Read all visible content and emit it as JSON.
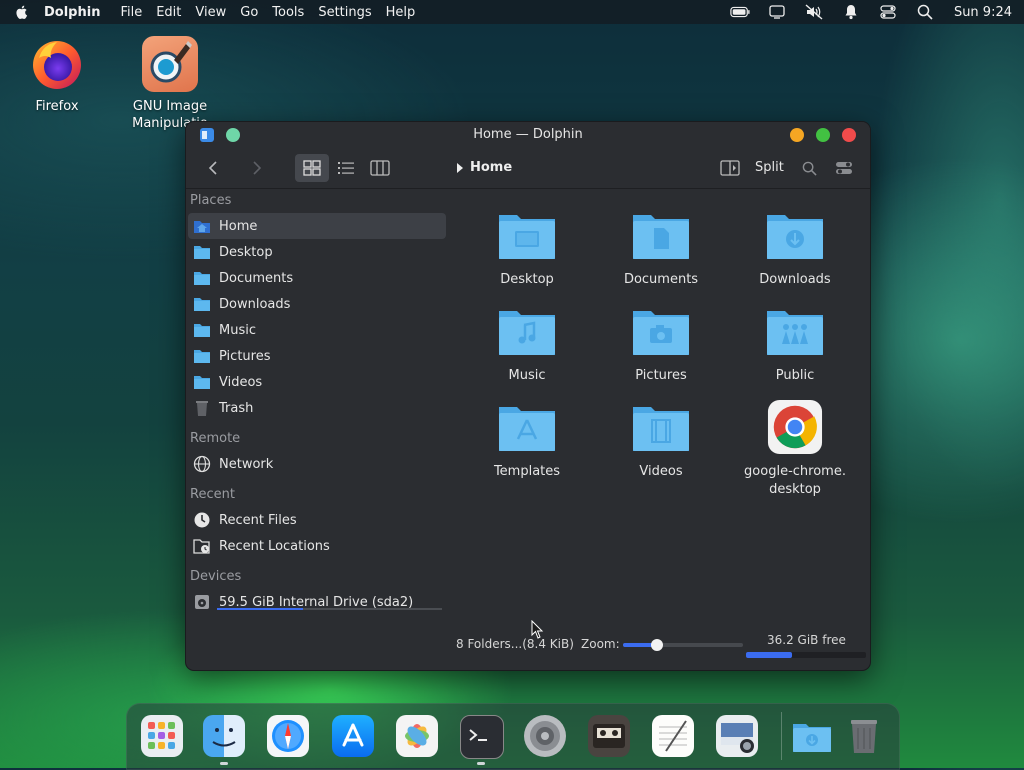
{
  "menubar": {
    "app_name": "Dolphin",
    "menus": [
      "File",
      "Edit",
      "View",
      "Go",
      "Tools",
      "Settings",
      "Help"
    ],
    "clock": "Sun 9:24",
    "status_icons": [
      "battery-icon",
      "display-icon",
      "mute-icon",
      "notification-icon",
      "control-center-icon",
      "search-icon"
    ]
  },
  "desktop": {
    "icons": [
      {
        "label": "Firefox",
        "icon": "firefox-icon"
      },
      {
        "label": "GNU Image Manipulatio",
        "icon": "gimp-icon"
      }
    ]
  },
  "window": {
    "title": "Home — Dolphin",
    "toolbar": {
      "back_icon": "chevron-left-icon",
      "forward_icon": "chevron-right-icon",
      "view_modes": [
        "icons-view-icon",
        "details-view-icon",
        "columns-view-icon"
      ],
      "breadcrumb": "Home",
      "split_label": "Split"
    },
    "sidebar": {
      "places_header": "Places",
      "places": [
        {
          "label": "Home",
          "icon": "home-folder-icon",
          "active": true
        },
        {
          "label": "Desktop",
          "icon": "folder-icon"
        },
        {
          "label": "Documents",
          "icon": "folder-icon"
        },
        {
          "label": "Downloads",
          "icon": "folder-icon"
        },
        {
          "label": "Music",
          "icon": "folder-icon"
        },
        {
          "label": "Pictures",
          "icon": "folder-icon"
        },
        {
          "label": "Videos",
          "icon": "folder-icon"
        },
        {
          "label": "Trash",
          "icon": "trash-icon"
        }
      ],
      "remote_header": "Remote",
      "remote": [
        {
          "label": "Network",
          "icon": "network-icon"
        }
      ],
      "recent_header": "Recent",
      "recent": [
        {
          "label": "Recent Files",
          "icon": "clock-icon"
        },
        {
          "label": "Recent Locations",
          "icon": "recent-locations-icon"
        }
      ],
      "devices_header": "Devices",
      "devices": [
        {
          "label": "59.5 GiB Internal Drive (sda2)",
          "icon": "drive-icon",
          "usage": 0.38
        }
      ]
    },
    "files": [
      {
        "label": "Desktop",
        "icon": "desktop-folder-icon"
      },
      {
        "label": "Documents",
        "icon": "documents-folder-icon"
      },
      {
        "label": "Downloads",
        "icon": "downloads-folder-icon"
      },
      {
        "label": "Music",
        "icon": "music-folder-icon"
      },
      {
        "label": "Pictures",
        "icon": "pictures-folder-icon"
      },
      {
        "label": "Public",
        "icon": "public-folder-icon"
      },
      {
        "label": "Templates",
        "icon": "templates-folder-icon"
      },
      {
        "label": "Videos",
        "icon": "videos-folder-icon"
      },
      {
        "label": "google-chrome.\ndesktop",
        "icon": "chrome-icon"
      }
    ],
    "status": {
      "summary": "8 Folders...(8.4 KiB)",
      "zoom_label": "Zoom:",
      "zoom_level": 0.28,
      "free_space": "36.2 GiB free",
      "free_bar": 0.38
    }
  },
  "dock": {
    "apps": [
      "launchpad-icon",
      "finder-icon",
      "safari-icon",
      "app-store-icon",
      "photos-icon",
      "terminal-icon",
      "system-settings-icon",
      "cassette-icon",
      "text-editor-icon",
      "screenshot-icon",
      "downloads-stack-icon",
      "trash-icon"
    ]
  },
  "colors": {
    "folder": "#5db3e6",
    "accent": "#3b6cf0",
    "close": "#f04b4b",
    "minimize": "#f5a623",
    "maximize": "#42c142"
  }
}
